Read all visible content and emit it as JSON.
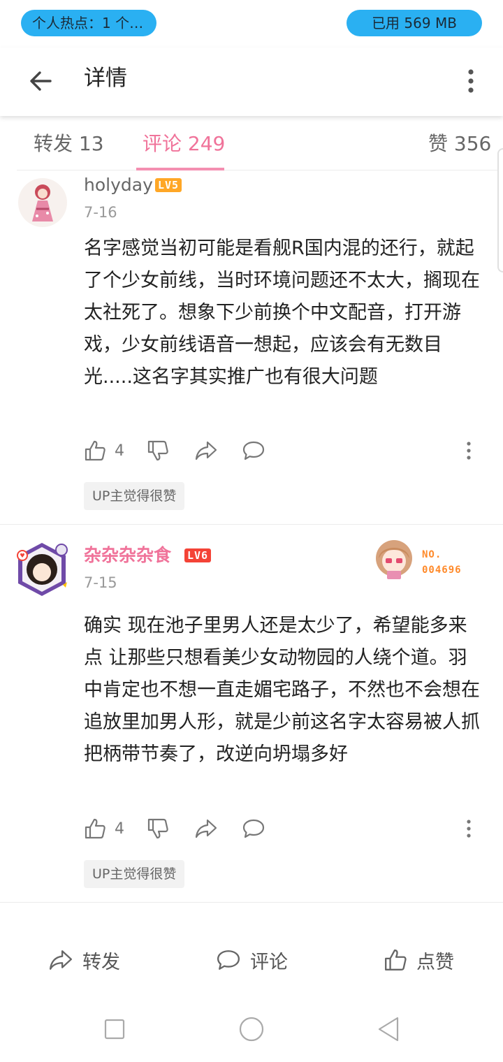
{
  "status_bar": {
    "hotspot_text": "个人热点：1 个连…",
    "memory_text": "已用 569 MB",
    "accent_color": "#2ab0f2"
  },
  "app_bar": {
    "title": "详情",
    "back_icon": "arrow-left-icon",
    "more_icon": "more-vertical-icon"
  },
  "tabs": {
    "repost": "转发 13",
    "comments": "评论 249",
    "likes": "赞 356",
    "active": "comments",
    "active_color": "#f0739a"
  },
  "comments": [
    {
      "username": "holyday",
      "level": "LV5",
      "date": "7-16",
      "content": "名字感觉当初可能是看舰R国内混的还行，就起了个少女前线，当时环境问题还不太大，搁现在太社死了。想象下少前换个中文配音，打开游戏，少女前线语音一想起，应该会有无数目光.....这名字其实推广也有很大问题",
      "likes": "4",
      "badge": "UP主觉得很赞"
    },
    {
      "username": "杂杂杂杂食",
      "level": "LV6",
      "date": "7-15",
      "fan_badge_label": "NO.",
      "fan_badge_number": "004696",
      "content": "确实 现在池子里男人还是太少了，希望能多来点 让那些只想看美少女动物园的人绕个道。羽中肯定也不想一直走媚宅路子，不然也不会想在追放里加男人形，就是少前这名字太容易被人抓把柄带节奏了，改逆向坍塌多好",
      "likes": "4",
      "badge": "UP主觉得很赞"
    }
  ],
  "bottom_bar": {
    "repost": "转发",
    "comment": "评论",
    "like": "点赞"
  },
  "nav_bar": {
    "recent_icon": "square-icon",
    "home_icon": "circle-icon",
    "back_icon": "triangle-back-icon"
  }
}
